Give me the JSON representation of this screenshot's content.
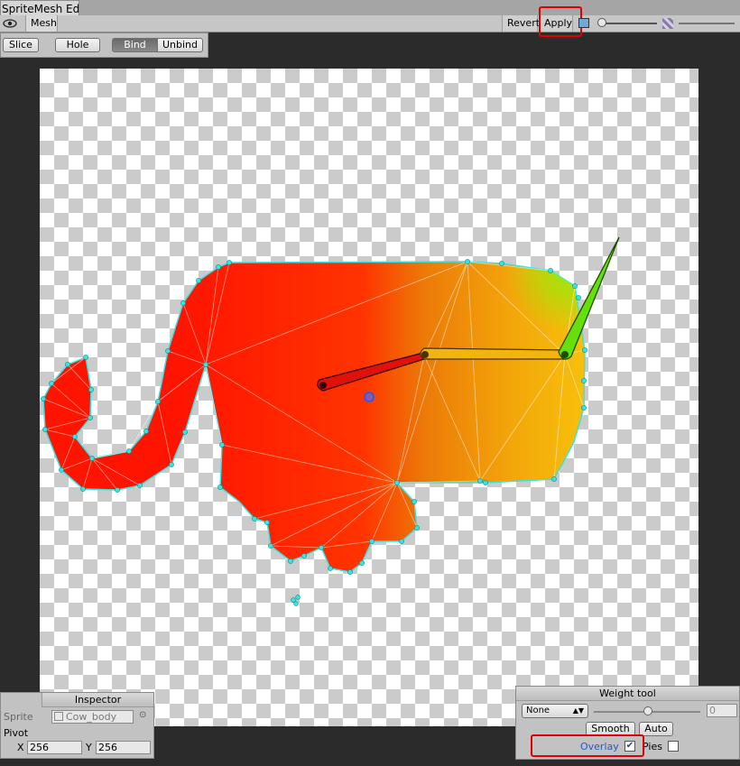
{
  "window": {
    "title": "SpriteMesh Edit"
  },
  "toolbar": {
    "mesh_tab": "Mesh",
    "revert_label": "Revert",
    "apply_label": "Apply",
    "zoom_slider": 0.0,
    "alpha_slider": 0.85
  },
  "modes": {
    "slice_label": "Slice",
    "hole_label": "Hole",
    "bind_label": "Bind",
    "unbind_label": "Unbind",
    "active": "Bind"
  },
  "inspector": {
    "title": "Inspector",
    "sprite_label": "Sprite",
    "sprite_value": "Cow_body",
    "pivot_label": "Pivot",
    "x_label": "X",
    "x_value": "256",
    "y_label": "Y",
    "y_value": "256"
  },
  "weight_tool": {
    "title": "Weight tool",
    "bone_select": "None",
    "weight_value": "0",
    "weight_slider": 0.5,
    "smooth_label": "Smooth",
    "auto_label": "Auto",
    "overlay_label": "Overlay",
    "overlay_checked": true,
    "pies_label": "Pies",
    "pies_checked": false
  },
  "colors": {
    "mesh_outline": "#33e6e6",
    "bone_red": "#e0110a",
    "bone_orange": "#f2b40f",
    "bone_green": "#66e00a",
    "highlight": "#e00000"
  }
}
